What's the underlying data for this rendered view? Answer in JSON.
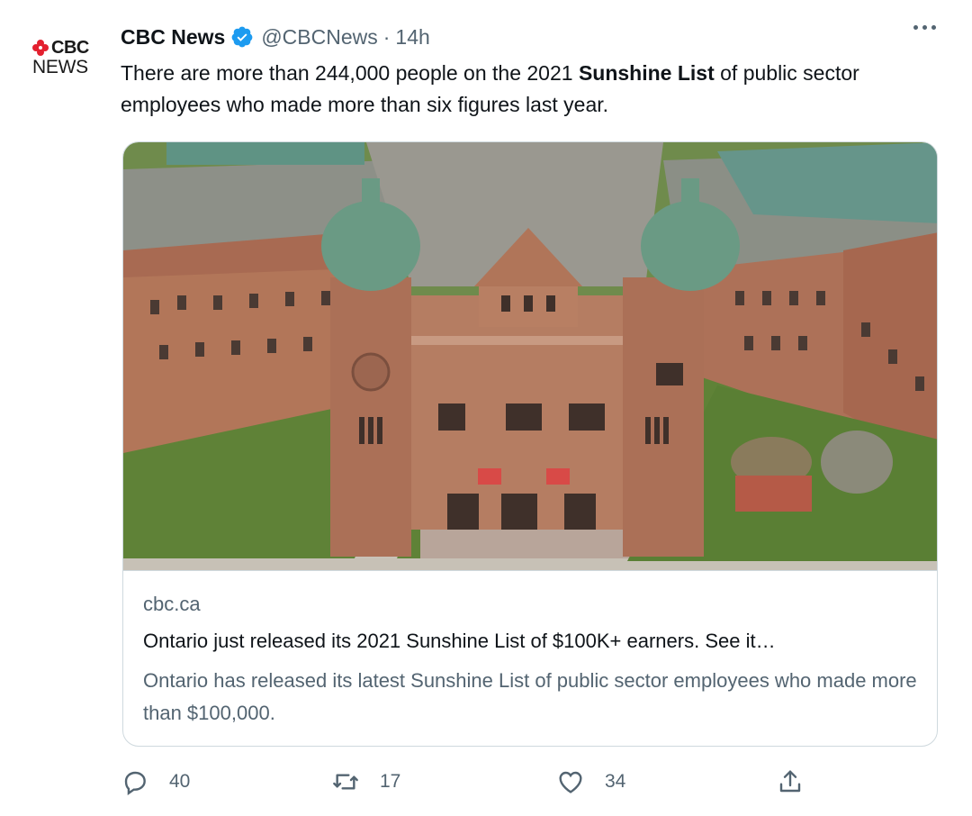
{
  "tweet": {
    "author_name": "CBC News",
    "handle": "@CBCNews",
    "separator": "·",
    "time": "14h",
    "text_before": "There are more than 244,000 people on the 2021 ",
    "text_bold": "Sunshine List",
    "text_after": " of public sector employees who made more than six figures last year."
  },
  "avatar": {
    "brand_top": "CBC",
    "brand_bottom": "NEWS",
    "gem_color": "#e3202f"
  },
  "card": {
    "domain": "cbc.ca",
    "title": "Ontario just released its 2021 Sunshine List of $100K+ earners. See it…",
    "description": "Ontario has released its latest Sunshine List of public sector employees who made more than $100,000."
  },
  "actions": {
    "replies": "40",
    "retweets": "17",
    "likes": "34"
  },
  "colors": {
    "verified": "#1d9bf0",
    "secondary_text": "#536471",
    "border": "#cfd9de"
  },
  "icons": [
    "verified-badge-icon",
    "more-icon",
    "reply-icon",
    "retweet-icon",
    "like-icon",
    "share-icon"
  ]
}
